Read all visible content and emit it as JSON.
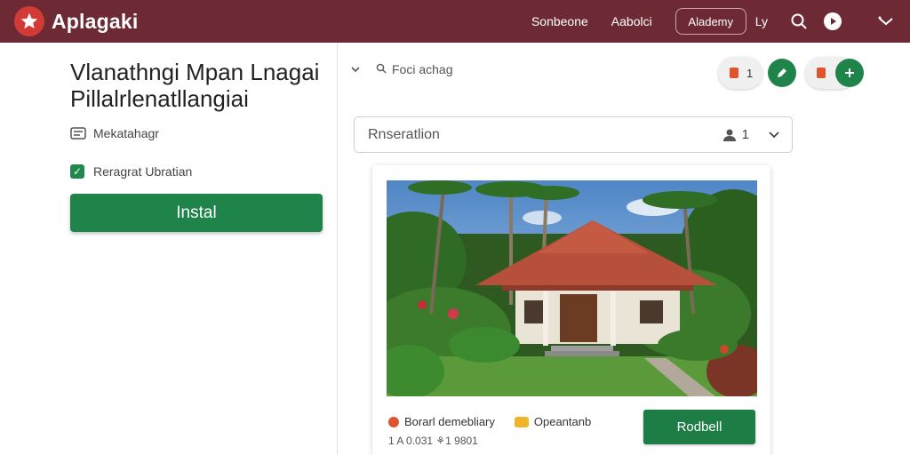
{
  "app": {
    "name": "Aplagaki"
  },
  "nav": {
    "link1": "Sonbeone",
    "link2": "Aabolci",
    "pill": "Alademy",
    "short": "Ly"
  },
  "listing": {
    "title": "Vlanathngi Mpan Lnagai Pillalrlenatllangiai",
    "meta": "Mekatahagr",
    "check_label": "Reragrat Ubratian",
    "install_label": "Instal"
  },
  "content": {
    "crumb": "Foci achag",
    "chip_a_count": "1",
    "select_value": "Rnseratlion",
    "select_people": "1"
  },
  "card": {
    "feature1": "Borarl demebliary",
    "feature2": "Opeantanb",
    "sub": "1 A 0.031  ⚘1 9801",
    "button_label": "Rodbell"
  },
  "colors": {
    "topbar": "#6d2a35",
    "brand_red": "#d23a36",
    "primary_green": "#1e8449",
    "accent_orange": "#e0542c"
  },
  "icons": [
    "star-logo-icon",
    "search-icon",
    "play-icon",
    "share-icon",
    "list-icon",
    "check-icon",
    "chevron-down-icon",
    "people-icon",
    "edit-icon",
    "plus-icon"
  ]
}
